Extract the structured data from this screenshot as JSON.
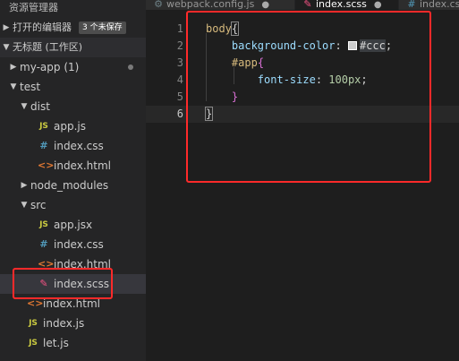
{
  "sidebar": {
    "title": "资源管理器",
    "open_editors": {
      "label": "打开的编辑器",
      "badge": "3 个未保存"
    },
    "workspace": {
      "label": "无标题 (工作区)"
    },
    "tree": [
      {
        "label": "my-app (1)",
        "kind": "folder",
        "open": false,
        "depth": 0,
        "modified": true
      },
      {
        "label": "test",
        "kind": "folder",
        "open": true,
        "depth": 0
      },
      {
        "label": "dist",
        "kind": "folder",
        "open": true,
        "depth": 1
      },
      {
        "label": "app.js",
        "kind": "js",
        "depth": 2
      },
      {
        "label": "index.css",
        "kind": "css",
        "depth": 2
      },
      {
        "label": "index.html",
        "kind": "html",
        "depth": 2
      },
      {
        "label": "node_modules",
        "kind": "folder",
        "open": false,
        "depth": 1
      },
      {
        "label": "src",
        "kind": "folder",
        "open": true,
        "depth": 1
      },
      {
        "label": "app.jsx",
        "kind": "js",
        "depth": 2
      },
      {
        "label": "index.css",
        "kind": "css",
        "depth": 2
      },
      {
        "label": "index.html",
        "kind": "html",
        "depth": 2
      },
      {
        "label": "index.scss",
        "kind": "scss",
        "depth": 2,
        "selected": true
      },
      {
        "label": "index.html",
        "kind": "html",
        "depth": 1
      },
      {
        "label": "index.js",
        "kind": "js",
        "depth": 1
      },
      {
        "label": "let.js",
        "kind": "js",
        "depth": 1
      }
    ]
  },
  "tabs": [
    {
      "label": "webpack.config.js",
      "icon": "gear-icon",
      "active": false
    },
    {
      "label": "index.scss",
      "icon": "scss-icon",
      "active": true
    },
    {
      "label": "index.css",
      "icon": "hash-icon",
      "active": false
    }
  ],
  "editor": {
    "current_line": 6,
    "lines": [
      {
        "num": "1",
        "tokens": [
          {
            "t": "body",
            "c": "sel"
          },
          {
            "t": "{",
            "c": "brace hl"
          }
        ]
      },
      {
        "num": "2",
        "tokens": [
          {
            "t": "    "
          },
          {
            "t": "background-color",
            "c": "prop"
          },
          {
            "t": ": ",
            "c": "punct"
          },
          {
            "swatch": "#cccccc"
          },
          {
            "t": "#ccc",
            "c": "color"
          },
          {
            "t": ";",
            "c": "punct"
          }
        ]
      },
      {
        "num": "3",
        "tokens": [
          {
            "t": "    "
          },
          {
            "t": "#app",
            "c": "sel"
          },
          {
            "t": "{",
            "c": "brace2"
          }
        ]
      },
      {
        "num": "4",
        "tokens": [
          {
            "t": "        "
          },
          {
            "t": "font-size",
            "c": "prop"
          },
          {
            "t": ": ",
            "c": "punct"
          },
          {
            "t": "100px",
            "c": "val"
          },
          {
            "t": ";",
            "c": "punct"
          }
        ]
      },
      {
        "num": "5",
        "tokens": [
          {
            "t": "    "
          },
          {
            "t": "}",
            "c": "brace2"
          }
        ]
      },
      {
        "num": "6",
        "tokens": [
          {
            "t": "}",
            "c": "brace hl"
          }
        ]
      }
    ]
  },
  "colors": {
    "annotation": "#ff2a2a",
    "js_icon": "#cbcb41",
    "css_icon": "#519aba",
    "html_icon": "#e37933",
    "scss_icon": "#f55385"
  }
}
